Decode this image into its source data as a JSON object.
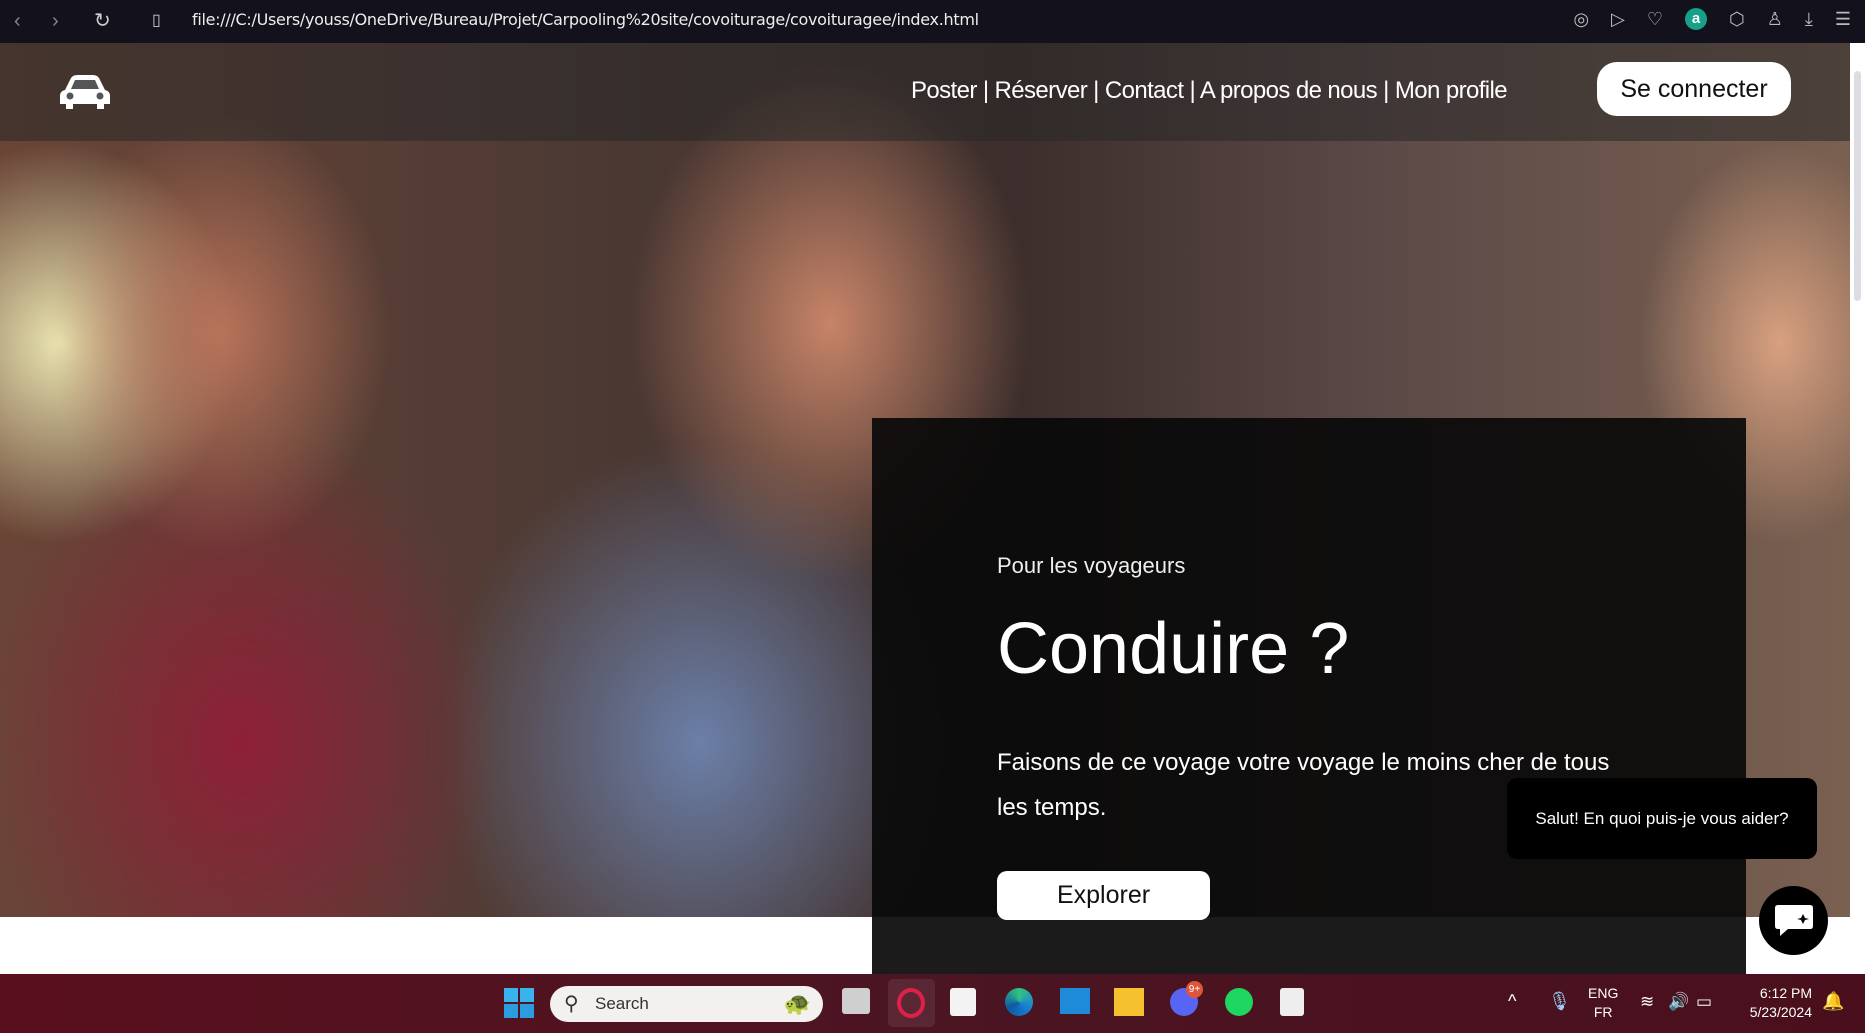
{
  "browser": {
    "url": "file:///C:/Users/youss/OneDrive/Bureau/Projet/Carpooling%20site/covoiturage/covoituragee/index.html",
    "extension_badge": "a"
  },
  "nav": {
    "links": [
      "Poster",
      "Réserver",
      "Contact",
      "A propos de nous",
      "Mon profile"
    ],
    "separator": " | ",
    "login_label": "Se connecter"
  },
  "hero": {
    "eyebrow": "Pour les voyageurs",
    "title": "Conduire ?",
    "description": "Faisons de ce voyage votre voyage le moins cher de tous les temps.",
    "cta_label": "Explorer"
  },
  "chat": {
    "bubble_text": "Salut! En quoi puis-je vous aider?"
  },
  "taskbar": {
    "search_placeholder": "Search",
    "discord_badge": "9+",
    "lang_primary": "ENG",
    "lang_secondary": "FR",
    "time": "6:12 PM",
    "date": "5/23/2024"
  },
  "colors": {
    "browser_bar": "#13121c",
    "taskbar": "#4b1522",
    "card": "#0a0a0a",
    "accent_extension": "#17a08a"
  }
}
